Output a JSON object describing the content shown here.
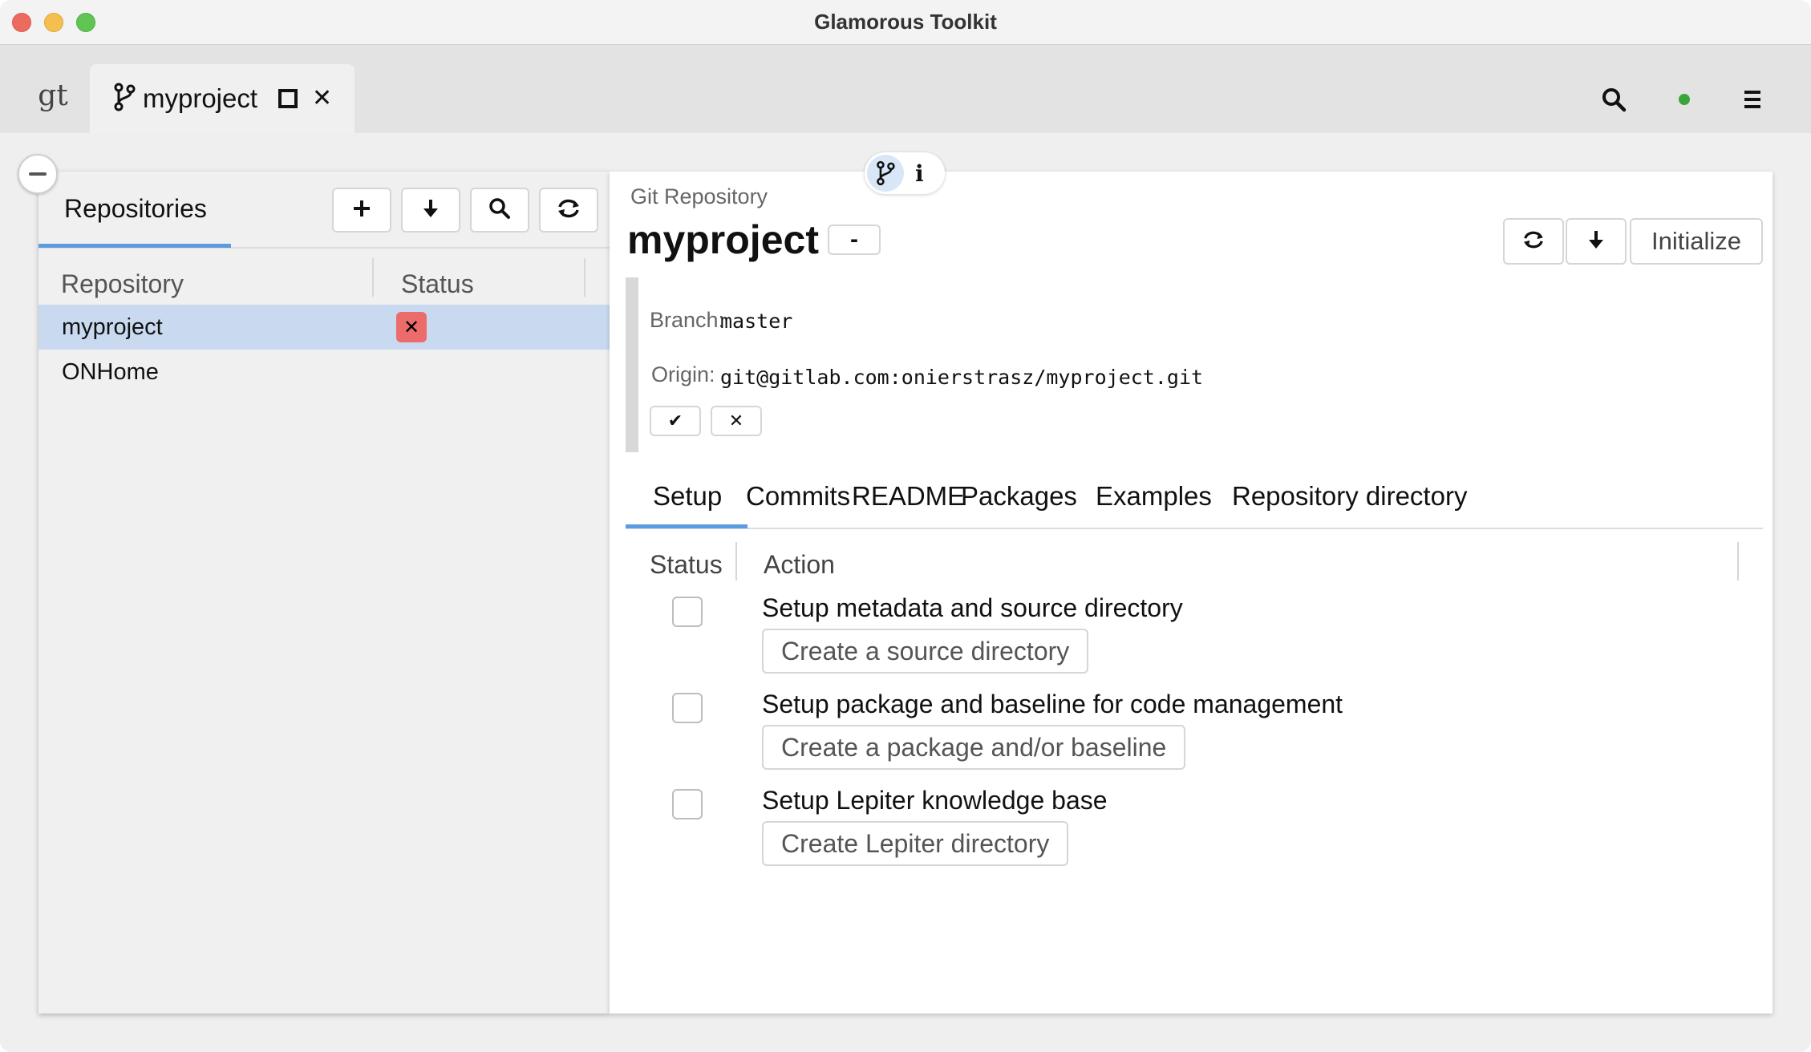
{
  "window": {
    "title": "Glamorous Toolkit"
  },
  "tabbar": {
    "home_tab_label": "gt",
    "project_tab_label": "myproject",
    "status_color": "#3aa53a"
  },
  "left": {
    "tab_label": "Repositories",
    "columns": {
      "repository": "Repository",
      "status": "Status"
    },
    "rows": [
      {
        "name": "myproject",
        "status_icon": "error-x-icon",
        "selected": true
      },
      {
        "name": "ONHome",
        "status_icon": "",
        "selected": false
      }
    ],
    "toolbar_icons": [
      "add-icon",
      "download-icon",
      "search-icon",
      "refresh-icon"
    ]
  },
  "right": {
    "kind_label": "Git Repository",
    "title": "myproject",
    "minus_label": "-",
    "initialize_label": "Initialize",
    "branch_key": "Branch:",
    "branch_value": "master",
    "origin_key": "Origin:",
    "origin_value": "git@gitlab.com:onierstrasz/myproject.git",
    "tabs": [
      "Setup",
      "Commits",
      "README",
      "Packages",
      "Examples",
      "Repository directory"
    ],
    "active_tab": "Setup",
    "setup_columns": {
      "status": "Status",
      "action": "Action"
    },
    "setup_items": [
      {
        "title": "Setup metadata and source directory",
        "button": "Create a source directory"
      },
      {
        "title": "Setup package and baseline for code management",
        "button": "Create a package and/or baseline"
      },
      {
        "title": "Setup Lepiter knowledge base",
        "button": "Create Lepiter directory"
      }
    ]
  },
  "colors": {
    "accent": "#5b9be0",
    "selected_row": "#c9daf0",
    "error": "#ec6b6b"
  }
}
